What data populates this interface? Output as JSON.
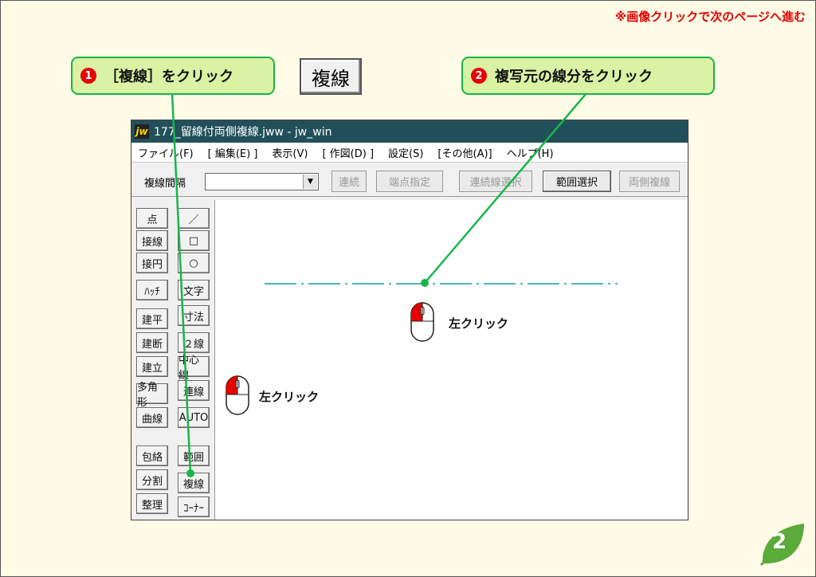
{
  "note": "※画像クリックで次のページへ進む",
  "callout1": {
    "num": "1",
    "text": "［複線］をクリック"
  },
  "callout2": {
    "num": "2",
    "text": "複写元の線分をクリック"
  },
  "big_button": "複線",
  "window": {
    "title": "177_留線付両側複線.jww - jw_win",
    "menu": [
      "ファイル(F)",
      "[ 編集(E) ]",
      "表示(V)",
      "[ 作図(D) ]",
      "設定(S)",
      "[その他(A)]",
      "ヘルプ(H)"
    ],
    "toolbar": {
      "label": "複線間隔",
      "buttons": [
        "連続",
        "端点指定",
        "連続線選択",
        "範囲選択",
        "両側複線"
      ]
    },
    "side_left": [
      "点",
      "接線",
      "接円",
      "ﾊｯﾁ",
      "建平",
      "建断",
      "建立",
      "多角形",
      "曲線",
      "包絡",
      "分割",
      "整理"
    ],
    "side_right": [
      "／",
      "□",
      "○",
      "文字",
      "寸法",
      "２線",
      "中心線",
      "連線",
      "AUTO",
      "範囲",
      "複線",
      "ｺｰﾅｰ"
    ]
  },
  "mouse_labels": [
    "左クリック",
    "左クリック"
  ],
  "page_number": "2",
  "colors": {
    "accent_green": "#18b548",
    "callout_fill": "#d9f2a4",
    "red": "#e60000",
    "titlebar": "#22505a"
  }
}
